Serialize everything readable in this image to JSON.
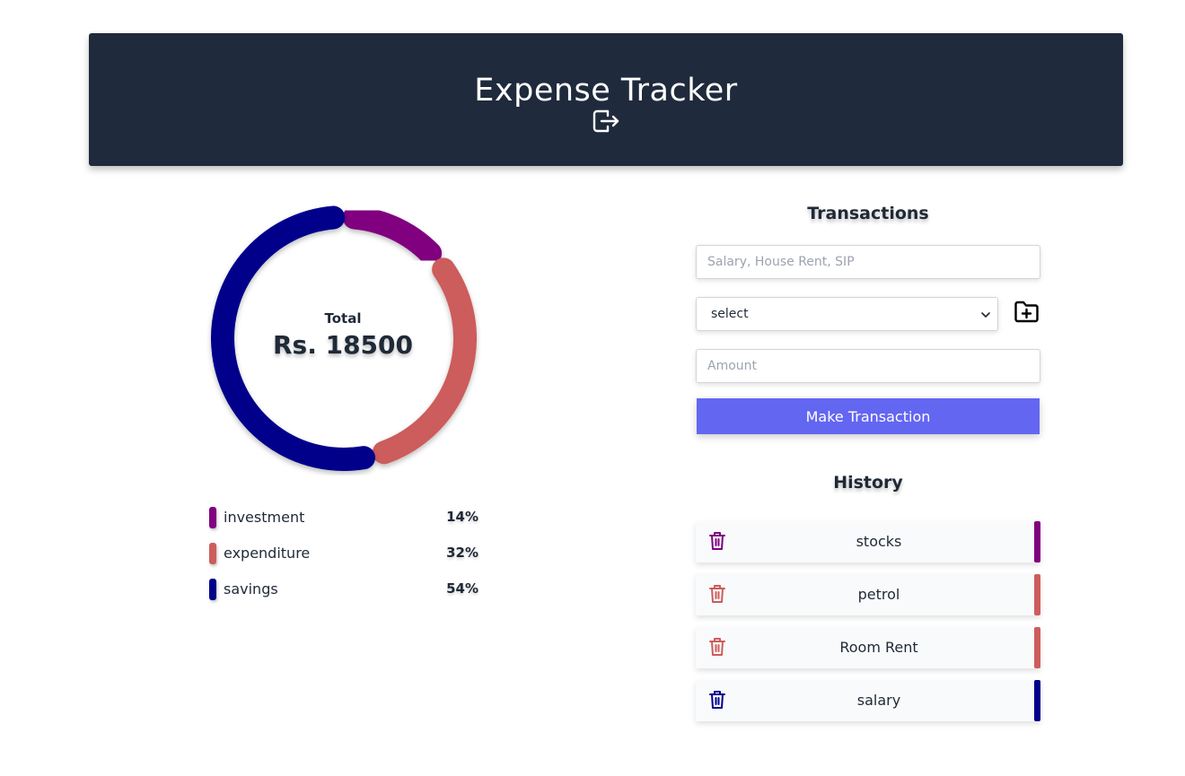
{
  "app": {
    "title": "Expense Tracker",
    "logout_icon": "logout-icon"
  },
  "chart_data": {
    "type": "pie",
    "variant": "doughnut",
    "center_label": "Total",
    "center_value": "Rs. 18500",
    "slices": [
      {
        "name": "investment",
        "value": 14,
        "color": "#800080"
      },
      {
        "name": "expenditure",
        "value": 32,
        "color": "#cd5c5c"
      },
      {
        "name": "savings",
        "value": 54,
        "color": "#00008b"
      }
    ],
    "legend": [
      {
        "name": "investment",
        "percent": "14%",
        "color": "#800080"
      },
      {
        "name": "expenditure",
        "percent": "32%",
        "color": "#cd5c5c"
      },
      {
        "name": "savings",
        "percent": "54%",
        "color": "#00008b"
      }
    ]
  },
  "transactions": {
    "title": "Transactions",
    "name_placeholder": "Salary, House Rent, SIP",
    "type_select": {
      "selected": "select",
      "icon": "chevron-down-icon"
    },
    "add_category_icon": "folder-plus-icon",
    "amount_placeholder": "Amount",
    "submit_label": "Make Transaction"
  },
  "history": {
    "title": "History",
    "items": [
      {
        "name": "stocks",
        "color": "#800080",
        "icon": "trash-icon"
      },
      {
        "name": "petrol",
        "color": "#cd5c5c",
        "icon": "trash-icon"
      },
      {
        "name": "Room Rent",
        "color": "#cd5c5c",
        "icon": "trash-icon"
      },
      {
        "name": "salary",
        "color": "#00008b",
        "icon": "trash-icon"
      }
    ]
  }
}
